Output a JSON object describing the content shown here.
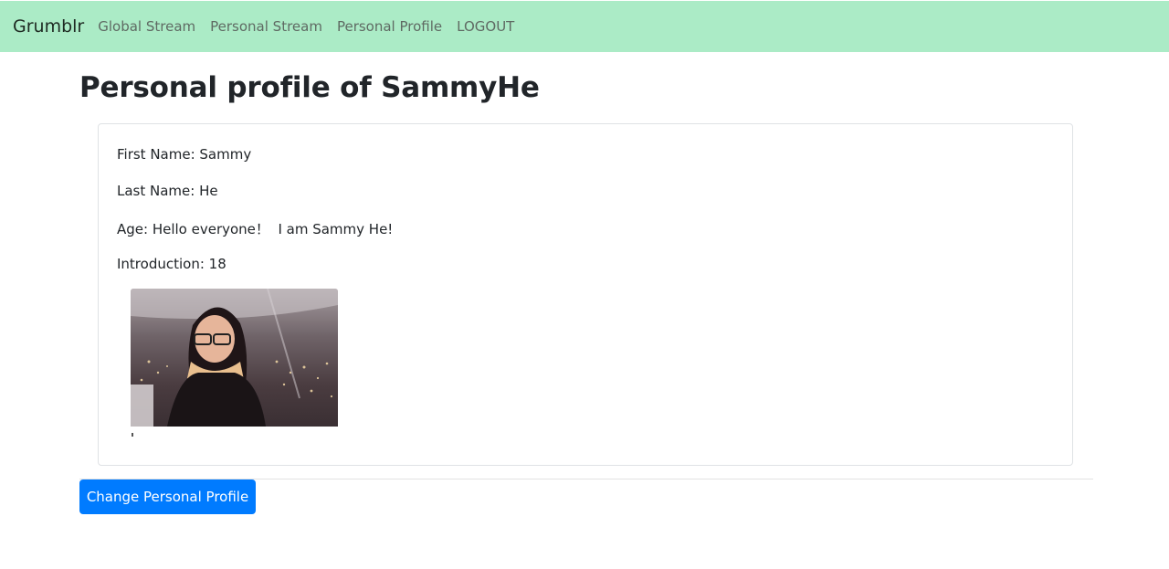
{
  "navbar": {
    "brand": "Grumblr",
    "links": [
      "Global Stream",
      "Personal Stream",
      "Personal Profile",
      "LOGOUT"
    ]
  },
  "page": {
    "title": "Personal profile of SammyHe"
  },
  "profile": {
    "first_name": "First Name: Sammy",
    "last_name": "Last Name: He",
    "age": "Age: Hello everyone！  I am Sammy He!",
    "introduction": "Introduction: 18"
  },
  "actions": {
    "change_profile_label": "Change Personal Profile"
  },
  "colors": {
    "navbar_bg": "#abebc6",
    "button_bg": "#007bff"
  }
}
